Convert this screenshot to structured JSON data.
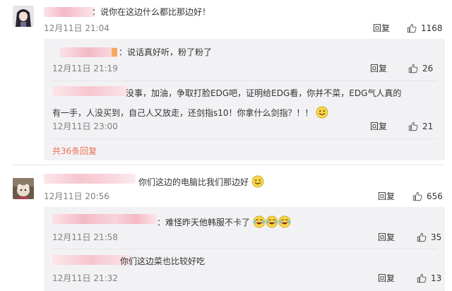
{
  "comments": [
    {
      "text": "：说你在这边什么都比那边好！",
      "time": "12月11日 21:04",
      "reply_label": "回复",
      "likes": "1168",
      "replies": [
        {
          "text": "：说话真好听，粉了粉了",
          "time": "12月11日 21:19",
          "reply_label": "回复",
          "likes": "26"
        },
        {
          "line1": "没事，加油，争取打脸EDG吧，证明给EDG看，你并不菜，EDG气人真的",
          "line2": "有一手，人没买到，自己人又放走，还剑指s10！你拿什么剑指？！！",
          "time": "12月11日 23:00",
          "reply_label": "回复",
          "likes": "21"
        }
      ],
      "more_replies": "共36条回复"
    },
    {
      "text": "你们这边的电脑比我们那边好",
      "time": "12月11日 20:56",
      "reply_label": "回复",
      "likes": "656",
      "replies": [
        {
          "text": "：难怪昨天他韩服不卡了",
          "time": "12月11日 21:58",
          "reply_label": "回复",
          "likes": "35"
        },
        {
          "text": "你们这边菜也比较好吃",
          "time": "12月11日 21:32",
          "reply_label": "回复",
          "likes": "13"
        }
      ]
    }
  ],
  "icons": {
    "like": "thumbs-up-icon",
    "smile": "smile-emoji-icon",
    "laugh": "laugh-tears-emoji-icon"
  },
  "colors": {
    "text": "#333333",
    "time": "#808080",
    "link": "#eb7350",
    "reply_bg": "#f2f2f5",
    "username_blur": "#f6c6d0"
  }
}
